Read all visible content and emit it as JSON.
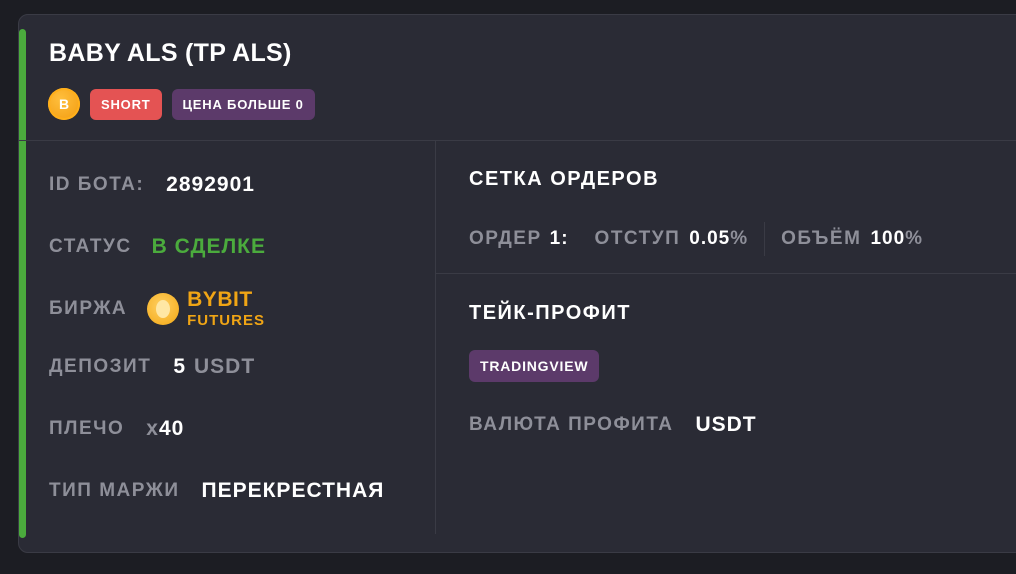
{
  "bot": {
    "title": "BABY ALS (TP ALS)",
    "coin_letter": "B",
    "side_badge": "SHORT",
    "condition_badge": "ЦЕНА БОЛЬШЕ 0",
    "accent_color": "#4bab3d"
  },
  "details": {
    "id_label": "ID БОТА:",
    "id_value": "2892901",
    "status_label": "СТАТУС",
    "status_value": "В СДЕЛКЕ",
    "exchange_label": "БИРЖА",
    "exchange_name": "BYBIT",
    "exchange_type": "FUTURES",
    "exchange_icon": "bybit-coin-icon",
    "deposit_label": "ДЕПОЗИТ",
    "deposit_amount": "5",
    "deposit_currency": "USDT",
    "leverage_label": "ПЛЕЧО",
    "leverage_prefix": "x",
    "leverage_value": "40",
    "margin_label": "ТИП МАРЖИ",
    "margin_value": "ПЕРЕКРЕСТНАЯ"
  },
  "grid": {
    "title": "СЕТКА ОРДЕРОВ",
    "order_label": "ОРДЕР",
    "order_number": "1:",
    "offset_label": "ОТСТУП",
    "offset_value": "0.05",
    "offset_unit": "%",
    "volume_label": "ОБЪЁМ",
    "volume_value": "100",
    "volume_unit": "%"
  },
  "take_profit": {
    "title": "ТЕЙК-ПРОФИТ",
    "source_badge": "TRADINGVIEW",
    "currency_label": "ВАЛЮТА ПРОФИТА",
    "currency_value": "USDT"
  }
}
